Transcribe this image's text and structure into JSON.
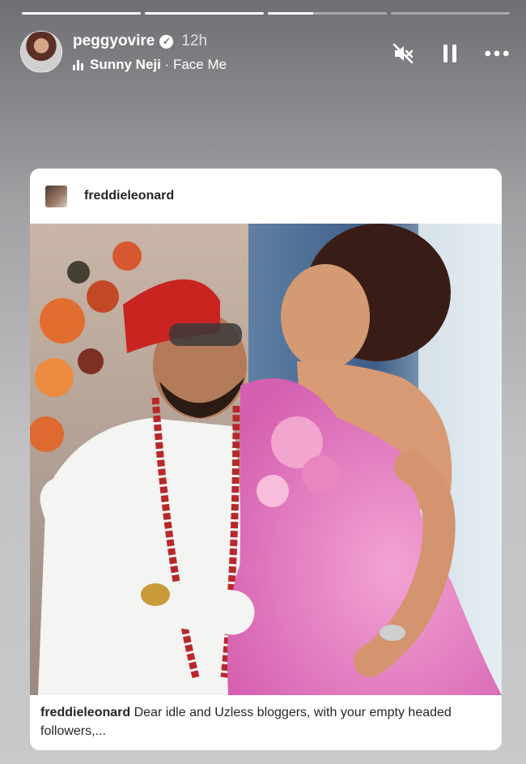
{
  "story": {
    "progress": [
      1,
      1,
      0.38,
      0
    ],
    "username": "peggyovire",
    "time": "12h",
    "music": {
      "artist": "Sunny Neji",
      "separator": " · ",
      "track": "Face Me"
    }
  },
  "post": {
    "username": "freddieleonard",
    "caption_user": "freddieleonard",
    "caption_text": "Dear idle and Uzless bloggers, with your empty headed followers,..."
  },
  "icons": {
    "verified": "verified-badge-icon",
    "mute": "speaker-muted-icon",
    "pause": "pause-icon",
    "more": "more-dots-icon",
    "music": "music-bars-icon"
  }
}
